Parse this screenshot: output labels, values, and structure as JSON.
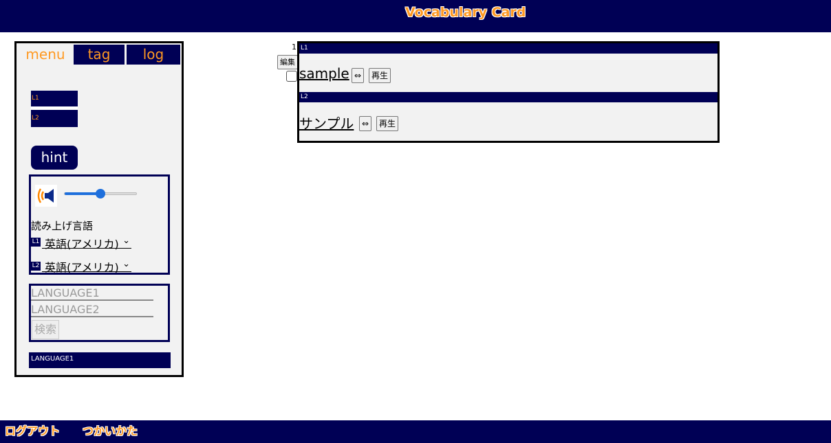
{
  "header": {
    "title": "Vocabulary Card"
  },
  "footer": {
    "logout": "ログアウト",
    "howto": "つかいかた"
  },
  "sidebar": {
    "tabs": [
      "menu",
      "tag",
      "log"
    ],
    "lang_box": {
      "l1": "L1",
      "l2": "L2"
    },
    "hint_label": "hint",
    "speech": {
      "volume_fraction": 0.5,
      "read_lang_label": "読み上げ言語",
      "l1_mark": "L1",
      "l2_mark": "L2",
      "l1_select": "英語(アメリカ)",
      "l2_select": "英語(アメリカ)"
    },
    "search": {
      "placeholder1": "LANGUAGE1",
      "placeholder2": "LANGUAGE2",
      "button": "検索"
    },
    "language_bar": "LANGUAGE1"
  },
  "card": {
    "number": "1",
    "edit_label": "編集",
    "l1_bar": "L1",
    "l2_bar": "L2",
    "l1_word": "sample",
    "l2_word": "サンプル",
    "swap_symbol": "⇔",
    "play_label": "再生"
  },
  "colors": {
    "navy": "#000055",
    "accent": "#ff9922",
    "panel_bg": "#f2f2f2"
  }
}
